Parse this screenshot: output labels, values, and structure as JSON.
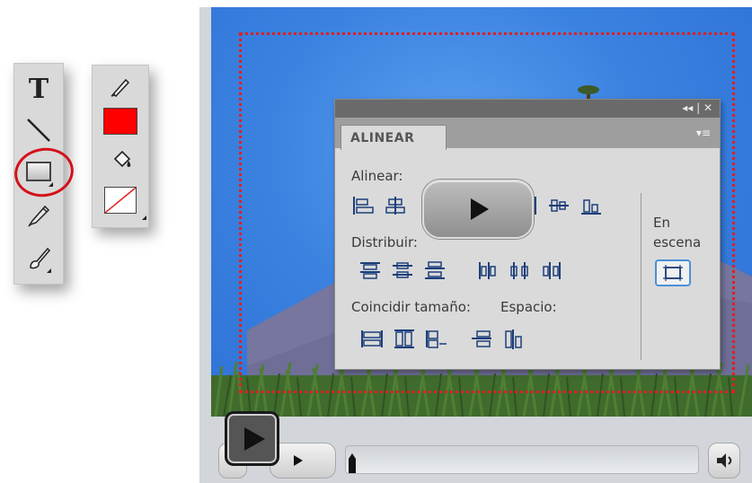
{
  "tools_left": {
    "text_tool": "T",
    "icons": [
      "text-tool-icon",
      "line-tool-icon",
      "rectangle-tool-icon",
      "pencil-tool-icon",
      "brush-tool-icon"
    ]
  },
  "tools_color": {
    "icons": [
      "stroke-color-icon",
      "fill-color-swatch",
      "paint-bucket-icon",
      "no-color-swatch"
    ],
    "fill_color": "#ff0000"
  },
  "align_panel": {
    "tab_label": "ALINEAR",
    "title_icons": "◂◂ | ✕",
    "menu_icon": "▾≡",
    "align_label": "Alinear:",
    "distribute_label": "Distribuir:",
    "match_size_label": "Coincidir tamaño:",
    "space_label": "Espacio:",
    "stage_label_line1": "En",
    "stage_label_line2": "escena"
  },
  "player": {
    "play_icon": "play-icon",
    "volume_icon": "volume-icon",
    "progress": 0.0
  },
  "colors": {
    "highlight": "#d4101a",
    "stage_border": "#e02020",
    "sky": "#3b82e0"
  }
}
